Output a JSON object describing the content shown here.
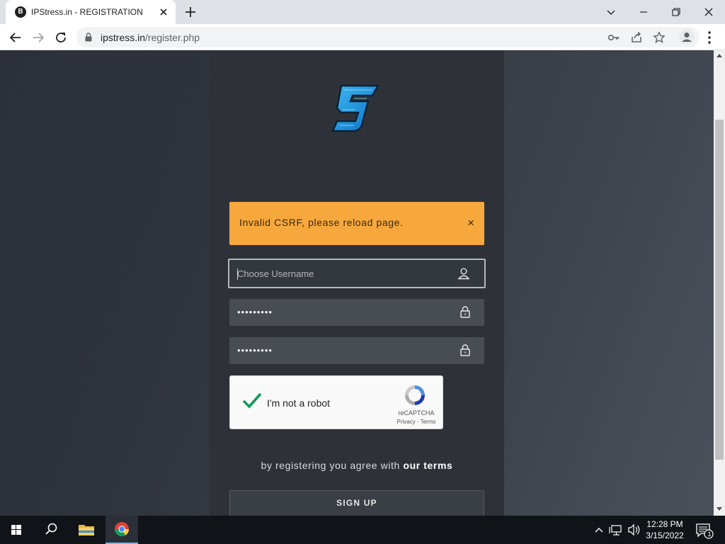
{
  "browser": {
    "tab_title": "IPStress.in - REGISTRATION",
    "favicon_letter": "B",
    "url_host": "ipstress.in",
    "url_path": "/register.php"
  },
  "page": {
    "alert_message": "Invalid CSRF, please reload page.",
    "alert_close": "×",
    "username_placeholder": "Choose Username",
    "password_mask": "•••••••••",
    "confirm_password_mask": "•••••••••",
    "recaptcha": {
      "label": "I'm not a robot",
      "brand": "reCAPTCHA",
      "links": "Privacy - Terms",
      "checked": true
    },
    "terms_prefix": "by registering you agree with ",
    "terms_link": "our terms",
    "signup_label": "SIGN UP"
  },
  "taskbar": {
    "time": "12:28 PM",
    "date": "3/15/2022",
    "notification_count": "1"
  },
  "colors": {
    "alert_bg": "#f7a83d",
    "panel_bg": "#2e3238",
    "logo_blue": "#1e9be3"
  }
}
